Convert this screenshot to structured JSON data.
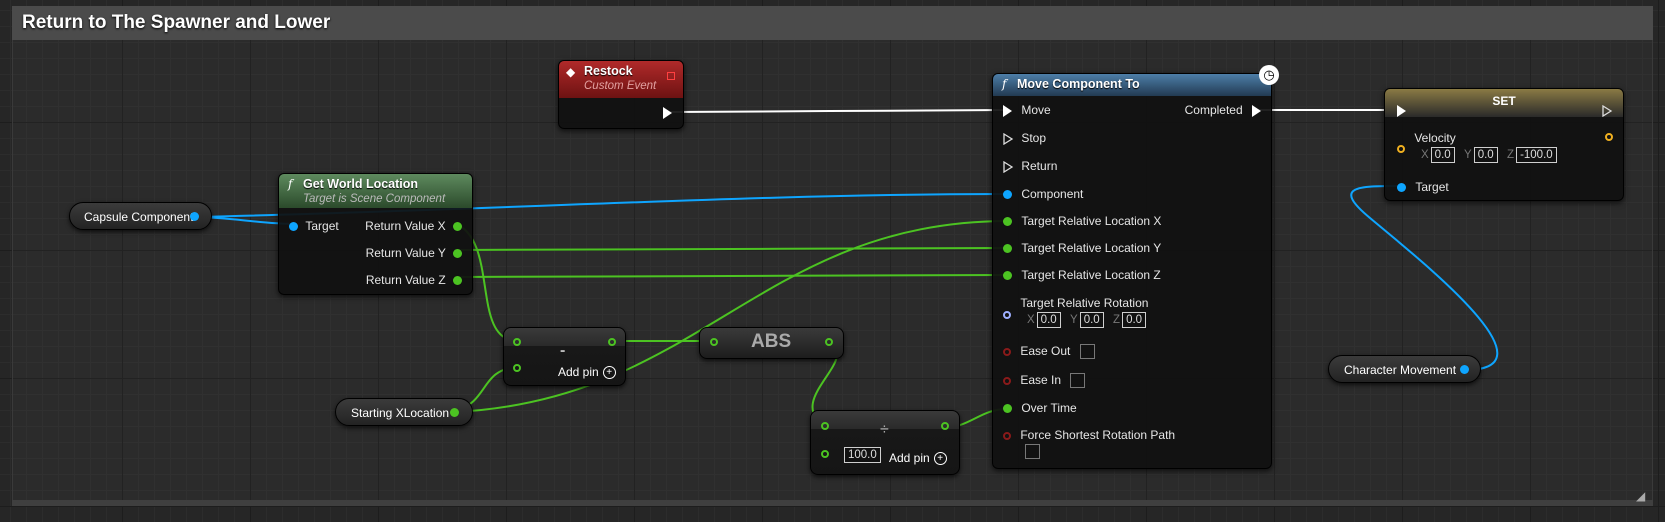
{
  "comment": {
    "title": "Return to The Spawner and Lower"
  },
  "colors": {
    "exec": "#ffffff",
    "object": "#0ea5ff",
    "float": "#5ac83a",
    "bool": "#9a1f1f",
    "struct": "#f0b020",
    "rotator": "#9fb0ff"
  },
  "nodes": {
    "restock": {
      "title": "Restock",
      "subtitle": "Custom Event"
    },
    "get_world_location": {
      "title": "Get World Location",
      "subtitle": "Target is Scene Component",
      "inputs": {
        "target": "Target"
      },
      "outputs": {
        "x": "Return Value X",
        "y": "Return Value Y",
        "z": "Return Value Z"
      }
    },
    "capsule": {
      "label": "Capsule Component"
    },
    "starting_x": {
      "label": "Starting XLocation"
    },
    "subtract": {
      "symbol": "-",
      "add_pin": "Add pin"
    },
    "abs": {
      "label": "ABS"
    },
    "divide": {
      "symbol": "÷",
      "value": "100.0",
      "add_pin": "Add pin"
    },
    "move_component_to": {
      "title": "Move Component To",
      "pins": {
        "move": "Move",
        "stop": "Stop",
        "return": "Return",
        "component": "Component",
        "loc_x": "Target Relative Location X",
        "loc_y": "Target Relative Location Y",
        "loc_z": "Target Relative Location Z",
        "rotation": "Target Relative Rotation",
        "rot_x": "0.0",
        "rot_y": "0.0",
        "rot_z": "0.0",
        "ease_out": "Ease Out",
        "ease_in": "Ease In",
        "over_time": "Over Time",
        "shortest": "Force Shortest Rotation Path",
        "completed": "Completed"
      }
    },
    "set": {
      "title": "SET",
      "velocity": "Velocity",
      "vx": "0.0",
      "vy": "0.0",
      "vz": "-100.0",
      "target": "Target",
      "axis_x": "X",
      "axis_y": "Y",
      "axis_z": "Z"
    },
    "character_movement": {
      "label": "Character Movement"
    }
  }
}
